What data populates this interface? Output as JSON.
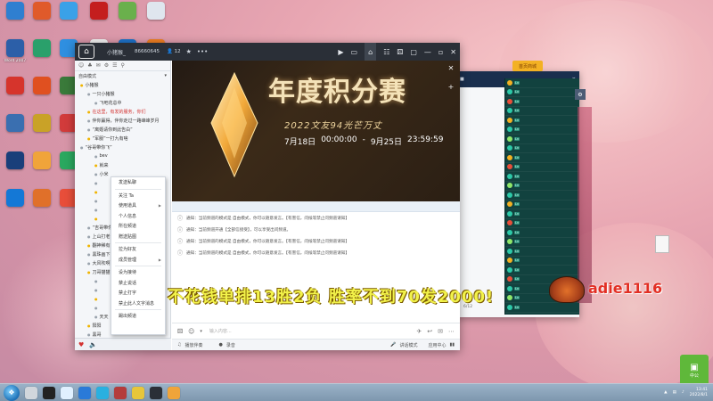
{
  "desktop": {
    "icons": [
      {
        "label": "",
        "color": "#2f7fd0"
      },
      {
        "label": "",
        "color": "#e05a2a"
      },
      {
        "label": "",
        "color": "#3aa1e8"
      },
      {
        "label": "",
        "color": "#c41e1e"
      },
      {
        "label": "",
        "color": "#6ab04c"
      },
      {
        "label": "",
        "color": "#dfe6ee"
      },
      {
        "label": "Word 2007",
        "color": "#2c5fa8"
      },
      {
        "label": "",
        "color": "#2aa06b"
      },
      {
        "label": "",
        "color": "#2f8fe0"
      },
      {
        "label": "",
        "color": "#f2f2f2"
      },
      {
        "label": "",
        "color": "#1d72c8"
      },
      {
        "label": "",
        "color": "#ef7e22"
      },
      {
        "label": "",
        "color": "#d6342c"
      },
      {
        "label": "",
        "color": "#e05020"
      },
      {
        "label": "",
        "color": "#3a7a3a"
      },
      {
        "label": "",
        "color": "#9a6a2a"
      },
      {
        "label": "",
        "color": "#1a9ee0"
      },
      {
        "label": "",
        "color": "#2fb24a"
      },
      {
        "label": "",
        "color": "#3a6fb0"
      },
      {
        "label": "",
        "color": "#c9a227"
      },
      {
        "label": "",
        "color": "#d23b3b"
      },
      {
        "label": "",
        "color": "#ffffff"
      },
      {
        "label": "",
        "color": "#42b24a"
      },
      {
        "label": "",
        "color": "#2e7bd6"
      },
      {
        "label": "",
        "color": "#1a3f7a"
      },
      {
        "label": "",
        "color": "#f0a43a"
      },
      {
        "label": "",
        "color": "#2aa85f"
      },
      {
        "label": "",
        "color": "#c9c9c9"
      },
      {
        "label": "",
        "color": "#27a744"
      },
      {
        "label": "",
        "color": "#4a4a4a"
      },
      {
        "label": "",
        "color": "#1478d6"
      },
      {
        "label": "",
        "color": "#e0702a"
      },
      {
        "label": "",
        "color": "#e84e3a"
      },
      {
        "label": "",
        "color": "#2a8adf"
      },
      {
        "label": "",
        "color": "#f5c542"
      }
    ],
    "file_label": "",
    "widget_label": "中公"
  },
  "client": {
    "user": "小猪猴_",
    "channel_id": "86660645",
    "online": "12",
    "sidebar": {
      "mode": "自由模式",
      "rows": [
        {
          "text": "小猪猴",
          "cls": ""
        },
        {
          "text": "一只小猪猴",
          "cls": "indent"
        },
        {
          "text": "飞吧花总中",
          "cls": "indent2"
        },
        {
          "text": "在这里，有发的服务，你们",
          "cls": "indent red"
        },
        {
          "text": "伴你赢得，伴你走过一路峰峰岁月",
          "cls": "indent"
        },
        {
          "text": "“离婚请你到此告白”",
          "cls": "indent"
        },
        {
          "text": "“军服”一打九有啥",
          "cls": "indent"
        },
        {
          "text": "“谷哥带你飞”",
          "cls": ""
        },
        {
          "text": "bev",
          "cls": "indent2"
        },
        {
          "text": "就来",
          "cls": "indent2"
        },
        {
          "text": "小米",
          "cls": "indent2"
        },
        {
          "text": "",
          "cls": "indent2"
        },
        {
          "text": "",
          "cls": "indent2"
        },
        {
          "text": "",
          "cls": "indent2"
        },
        {
          "text": "",
          "cls": "indent2"
        },
        {
          "text": "",
          "cls": "indent2"
        },
        {
          "text": "“吉哥带你”",
          "cls": "indent"
        },
        {
          "text": "上山打老",
          "cls": "indent"
        },
        {
          "text": "翻神稀有",
          "cls": "indent"
        },
        {
          "text": "黑珠画下",
          "cls": "indent"
        },
        {
          "text": "大风吹啊",
          "cls": "indent"
        },
        {
          "text": "刀哥猫猫",
          "cls": "indent"
        },
        {
          "text": "",
          "cls": "indent2"
        },
        {
          "text": "",
          "cls": "indent2"
        },
        {
          "text": "",
          "cls": "indent2"
        },
        {
          "text": "",
          "cls": "indent2"
        },
        {
          "text": "天天",
          "cls": "indent2"
        },
        {
          "text": "阳阳",
          "cls": "indent"
        },
        {
          "text": "黑哥",
          "cls": "indent"
        },
        {
          "text": "",
          "cls": "indent"
        }
      ]
    },
    "context_menu": [
      {
        "label": "发送私聊",
        "arrow": false
      },
      {
        "label": "关注 Ta",
        "arrow": false
      },
      {
        "label": "使用道具",
        "arrow": true
      },
      {
        "label": "个人信息",
        "arrow": false
      },
      {
        "label": "所在频道",
        "arrow": false
      },
      {
        "label": "赠送贴图",
        "arrow": false
      },
      {
        "label": "拉为好友",
        "arrow": false
      },
      {
        "label": "成员管理",
        "arrow": true
      },
      {
        "label": "设为接待",
        "arrow": false
      },
      {
        "label": "禁止说话",
        "arrow": false
      },
      {
        "label": "禁止打字",
        "arrow": false
      },
      {
        "label": "禁止此人文字消息",
        "arrow": false
      },
      {
        "label": "踢出频道",
        "arrow": false
      }
    ],
    "banner": {
      "title": "年度积分赛",
      "subtitle": "2022文友94光芒万丈",
      "date_start": "7月18日",
      "time_start": "00:00:00",
      "date_end": "9月25日",
      "time_end": "23:59:59"
    },
    "notices": [
      "通知：当前频道的模式是 自由模式，你可以随意发言。【有害信，问候等禁止问频道请知】",
      "通知：当前频道开通【全部信接受】，可以享受出问频道。",
      "通知：当前频道的模式是 自由模式，你可以随意发言。【有害信，问候等禁止问频道请知】",
      "通知：当前频道的模式是 自由模式，你可以随意发言。【有害信，问候等禁止问频道请知】"
    ],
    "input_placeholder": "输入内容...",
    "status": {
      "play": "播放伴奏",
      "record": "录音",
      "mode": "讲话模式",
      "app": "应用中心"
    }
  },
  "overlay": {
    "caption": "不花钱单排13胜2负  胜率不到70发2000!",
    "nickname": "adie1116"
  },
  "win2": {
    "tab_label": "首页商城",
    "page": "6/12",
    "list": [
      {
        "name": "",
        "dot": "#f3b123"
      },
      {
        "name": "",
        "dot": "#2cc9a8"
      },
      {
        "name": "",
        "dot": "#e84e3a"
      },
      {
        "name": "",
        "dot": "#2cc9a8"
      },
      {
        "name": "",
        "dot": "#f3b123"
      },
      {
        "name": "",
        "dot": "#2cc9a8"
      },
      {
        "name": "",
        "dot": "#8fe86a"
      },
      {
        "name": "",
        "dot": "#2cc9a8"
      },
      {
        "name": "",
        "dot": "#f3b123"
      },
      {
        "name": "",
        "dot": "#e84e3a"
      },
      {
        "name": "",
        "dot": "#2cc9a8"
      },
      {
        "name": "",
        "dot": "#8fe86a"
      },
      {
        "name": "",
        "dot": "#2cc9a8"
      },
      {
        "name": "",
        "dot": "#f3b123"
      },
      {
        "name": "",
        "dot": "#2cc9a8"
      },
      {
        "name": "",
        "dot": "#e84e3a"
      },
      {
        "name": "",
        "dot": "#2cc9a8"
      },
      {
        "name": "",
        "dot": "#8fe86a"
      },
      {
        "name": "",
        "dot": "#2cc9a8"
      },
      {
        "name": "",
        "dot": "#f3b123"
      },
      {
        "name": "",
        "dot": "#2cc9a8"
      },
      {
        "name": "",
        "dot": "#e84e3a"
      },
      {
        "name": "",
        "dot": "#2cc9a8"
      },
      {
        "name": "",
        "dot": "#8fe86a"
      },
      {
        "name": "",
        "dot": "#2cc9a8"
      }
    ]
  },
  "taskbar": {
    "time": "13:41",
    "date": "2022/8/1"
  }
}
